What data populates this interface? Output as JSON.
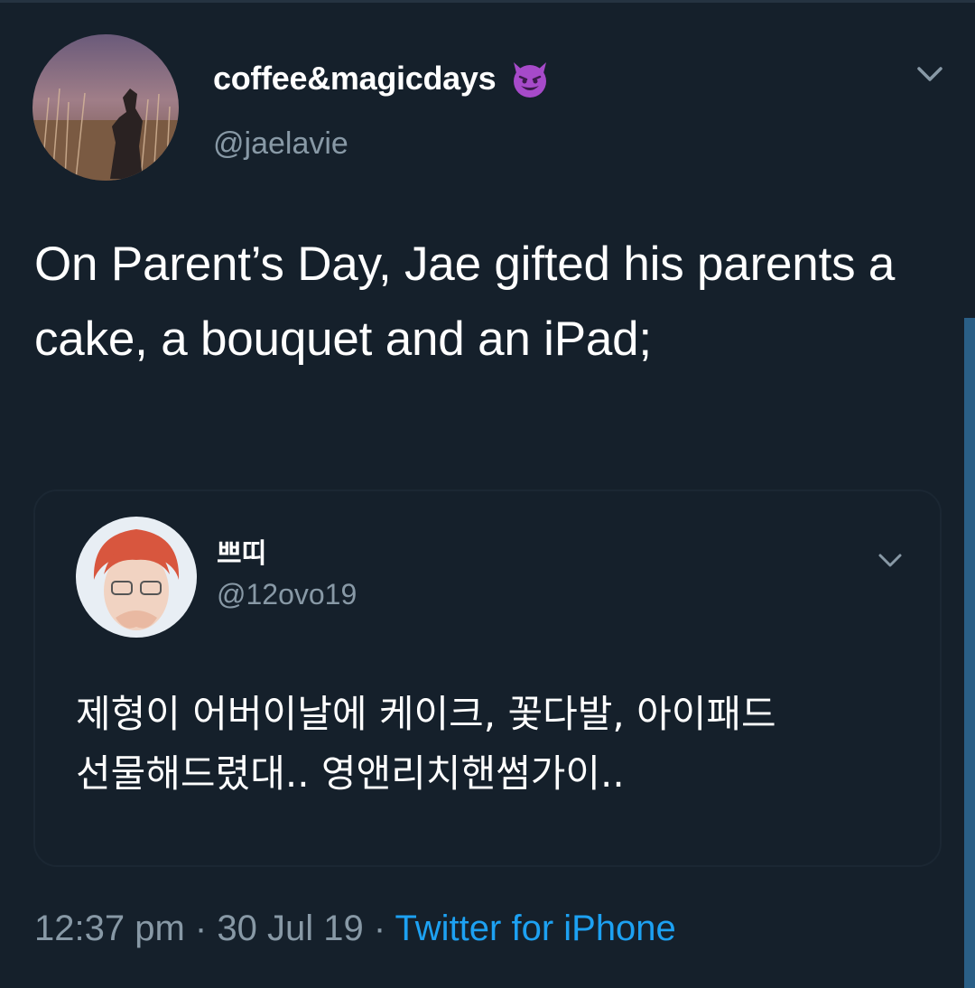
{
  "tweet": {
    "display_name": "coffee&magicdays",
    "name_emoji": "smiling-devil-emoji",
    "handle": "@jaelavie",
    "text": "On Parent’s Day, Jae gifted his parents a cake, a bouquet and an iPad;",
    "time": "12:37 pm",
    "separator": "·",
    "date": "30 Jul 19",
    "source": "Twitter for iPhone"
  },
  "quoted_tweet": {
    "display_name": "쁘띠",
    "handle": "@12ovo19",
    "text": "제형이 어버이날에 케이크, 꽃다발, 아이패드 선물해드렸대.. 영앤리치핸썸가이.."
  },
  "colors": {
    "background": "#15202b",
    "secondary_text": "#8899a6",
    "link": "#1da1f2",
    "border": "#1b2733"
  }
}
